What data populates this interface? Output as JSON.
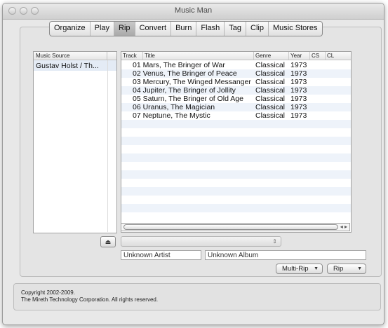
{
  "window": {
    "title": "Music Man"
  },
  "tabs": [
    "Organize",
    "Play",
    "Rip",
    "Convert",
    "Burn",
    "Flash",
    "Tag",
    "Clip",
    "Music Stores"
  ],
  "active_tab": "Rip",
  "source_panel": {
    "header": "Music Source",
    "items": [
      "Gustav Holst / Th..."
    ]
  },
  "track_table": {
    "headers": [
      "Track",
      "Title",
      "Genre",
      "Year",
      "CS",
      "CL"
    ],
    "rows": [
      {
        "title": "01  Mars, The Bringer of War",
        "genre": "Classical",
        "year": "1973"
      },
      {
        "title": "02  Venus, The Bringer of Peace",
        "genre": "Classical",
        "year": "1973"
      },
      {
        "title": "03  Mercury, The Winged Messanger",
        "genre": "Classical",
        "year": "1973"
      },
      {
        "title": "04  Jupiter, The Bringer of Jollity",
        "genre": "Classical",
        "year": "1973"
      },
      {
        "title": "05  Saturn, The Bringer of Old Age",
        "genre": "Classical",
        "year": "1973"
      },
      {
        "title": "06  Uranus, The Magician",
        "genre": "Classical",
        "year": "1973"
      },
      {
        "title": "07  Neptune, The Mystic",
        "genre": "Classical",
        "year": "1973"
      }
    ]
  },
  "icons": {
    "eject": "eject-icon"
  },
  "fields": {
    "artist": "Unknown Artist",
    "album": "Unknown Album"
  },
  "buttons": {
    "multi_rip": "Multi-Rip",
    "rip": "Rip"
  },
  "footer": {
    "line1": "Copyright 2002-2009.",
    "line2": "The Mireth Technology Corporation. All rights reserved."
  }
}
